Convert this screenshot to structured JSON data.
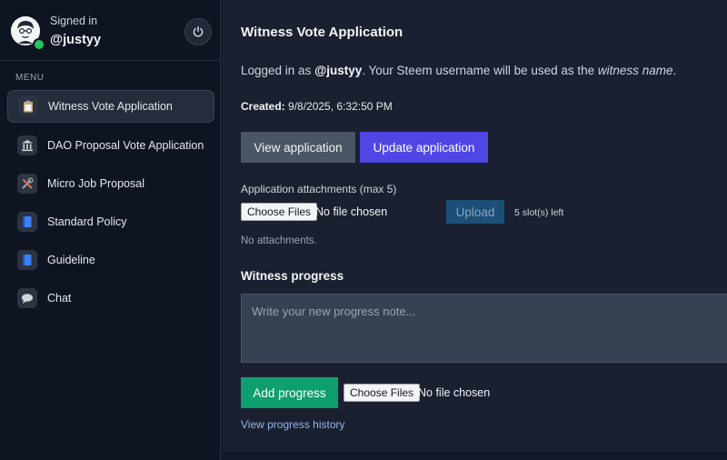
{
  "user": {
    "signed_in_label": "Signed in",
    "username": "@justyy",
    "status_color": "#22c55e"
  },
  "sidebar": {
    "menu_label": "MENU",
    "items": [
      {
        "label": "Witness Vote Application",
        "icon": "clipboard-icon",
        "active": true
      },
      {
        "label": "DAO Proposal Vote Application",
        "icon": "bank-icon",
        "active": false
      },
      {
        "label": "Micro Job Proposal",
        "icon": "tools-icon",
        "active": false
      },
      {
        "label": "Standard Policy",
        "icon": "book-icon",
        "active": false
      },
      {
        "label": "Guideline",
        "icon": "book-icon",
        "active": false
      },
      {
        "label": "Chat",
        "icon": "speech-bubble-icon",
        "active": false
      }
    ]
  },
  "main": {
    "title": "Witness Vote Application",
    "logged_prefix": "Logged in as ",
    "logged_user": "@justyy",
    "logged_middle": ". Your Steem username will be used as the ",
    "logged_em": "witness name",
    "logged_suffix": ".",
    "created_label": "Created:",
    "created_value": " 9/8/2025, 6:32:50 PM",
    "view_button": "View application",
    "update_button": "Update application",
    "attachments_label": "Application attachments (max 5)",
    "choose_files": "Choose Files",
    "no_file_chosen": "No file chosen",
    "upload_button": "Upload",
    "slots_left": "5 slot(s) left",
    "no_attachments": "No attachments.",
    "progress_title": "Witness progress",
    "progress_placeholder": "Write your new progress note...",
    "add_progress_button": "Add progress",
    "progress_choose_files": "Choose Files",
    "progress_no_file_chosen": "No file chosen",
    "history_link": "View progress history"
  },
  "colors": {
    "accent": "#5046e5",
    "success": "#0e9f6e",
    "upload": "#1b4f77"
  }
}
